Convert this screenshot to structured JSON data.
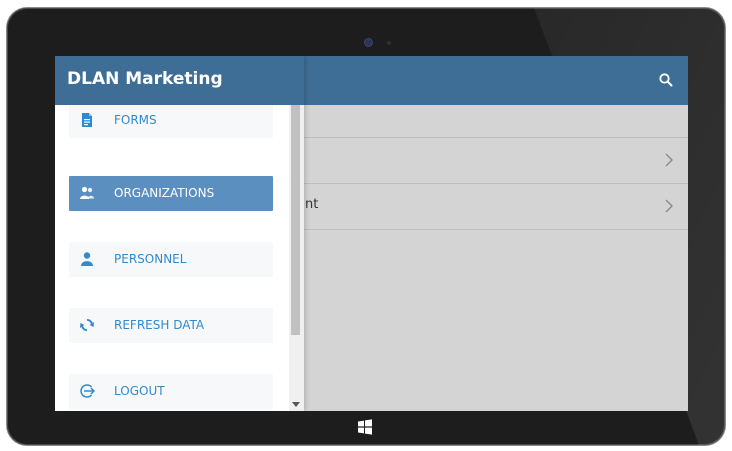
{
  "app": {
    "title": "DLAN Marketing"
  },
  "drawer": {
    "items": [
      {
        "label": "FORMS",
        "icon": "document-icon",
        "active": false
      },
      {
        "label": "ORGANIZATIONS",
        "icon": "people-icon",
        "active": true
      },
      {
        "label": "PERSONNEL",
        "icon": "person-icon",
        "active": false
      },
      {
        "label": "REFRESH DATA",
        "icon": "refresh-icon",
        "active": false
      },
      {
        "label": "LOGOUT",
        "icon": "logout-icon",
        "active": false
      }
    ]
  },
  "main": {
    "rows": [
      {
        "text": ""
      },
      {
        "text": "nt"
      }
    ]
  },
  "colors": {
    "header": "#3e6e96",
    "active_item": "#5b8fc0",
    "label": "#2e8bd0",
    "content_bg": "#d4d4d4"
  }
}
